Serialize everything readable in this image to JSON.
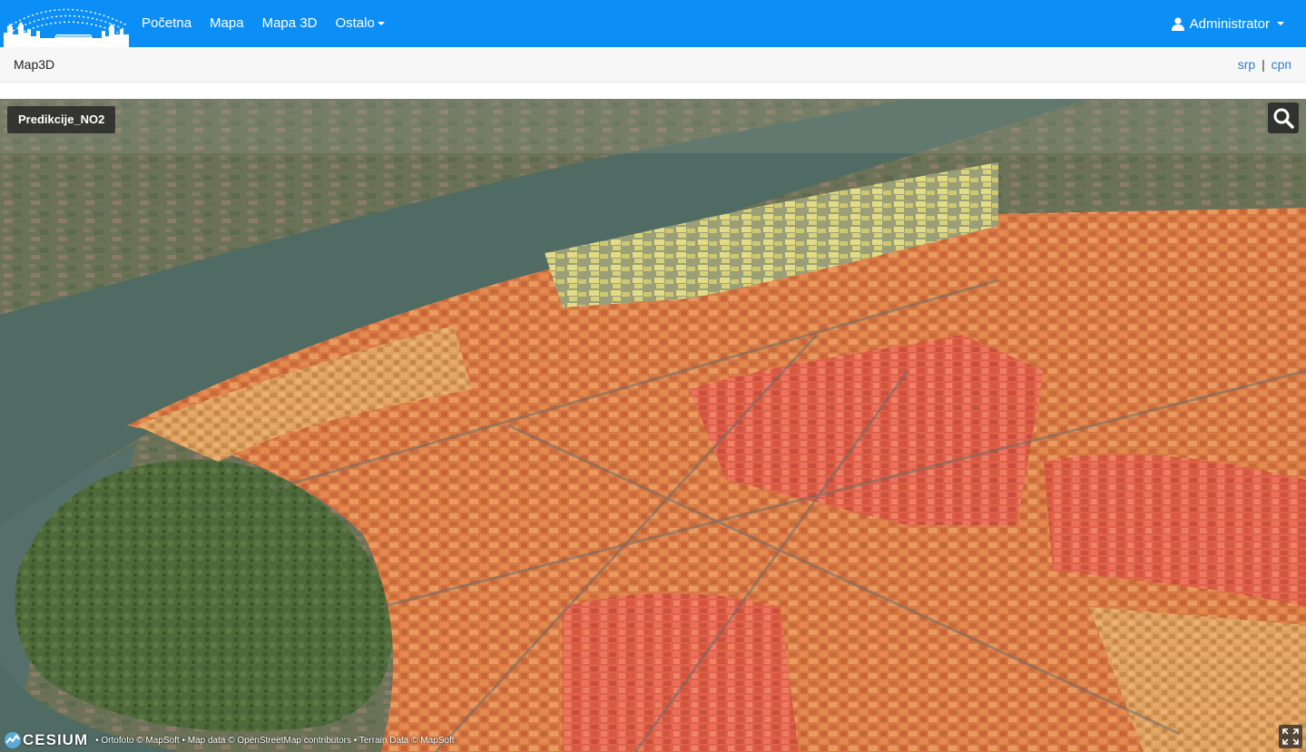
{
  "nav": {
    "links": [
      {
        "label": "Početna"
      },
      {
        "label": "Mapa"
      },
      {
        "label": "Mapa 3D"
      },
      {
        "label": "Ostalo"
      }
    ],
    "user_label": "Administrator"
  },
  "subbar": {
    "page_title": "Map3D",
    "lang_latin": "srp",
    "lang_separator": "|",
    "lang_cyrillic": "срп"
  },
  "viewer": {
    "layer_label": "Predikcije_NO2",
    "logo_text": "CESIUM",
    "attribution": "• Ortofoto © MapSoft • Map data © OpenStreetMap contributors • Terrain Data © MapSoft"
  },
  "icons": {
    "brand": "city-skyline-logo",
    "user": "user-icon",
    "search": "search-icon",
    "fullscreen": "fullscreen-icon"
  },
  "colors": {
    "navbar": "#0b8ff7",
    "link": "#2a7fd4",
    "river": "#4f6b63",
    "building_low": "#e3d97a",
    "building_mid": "#e8a25a",
    "building_high": "#e26a3c",
    "building_peak": "#e04a4a"
  }
}
